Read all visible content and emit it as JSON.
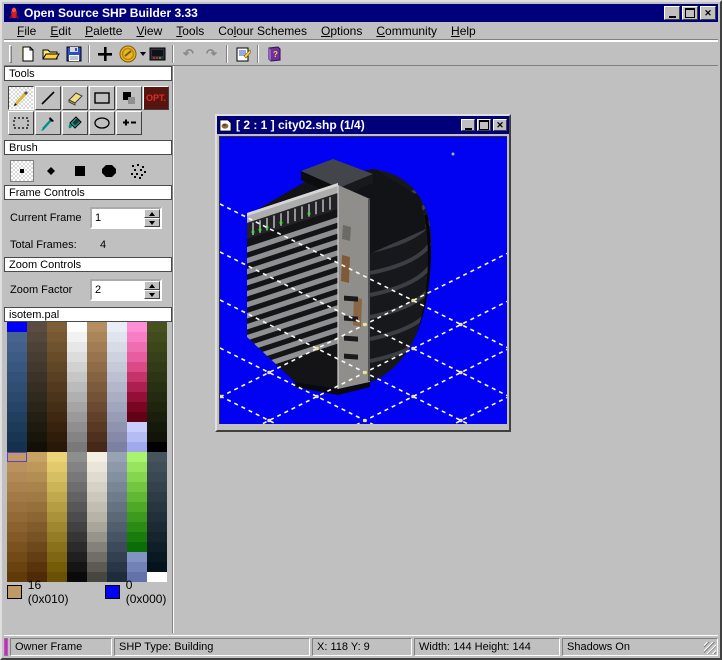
{
  "window": {
    "title": "Open Source SHP Builder 3.33"
  },
  "menu": {
    "items": [
      {
        "label": "File",
        "underline": 0
      },
      {
        "label": "Edit",
        "underline": 0
      },
      {
        "label": "Palette",
        "underline": 0
      },
      {
        "label": "View",
        "underline": 0
      },
      {
        "label": "Tools",
        "underline": 0
      },
      {
        "label": "Colour Schemes",
        "underline": 2
      },
      {
        "label": "Options",
        "underline": 0
      },
      {
        "label": "Community",
        "underline": 0
      },
      {
        "label": "Help",
        "underline": 0
      }
    ]
  },
  "toolbar": {
    "icons": [
      "new-file-icon",
      "open-file-icon",
      "save-file-icon",
      "plus-icon",
      "palette-coin-icon",
      "dropdown-arrow-icon",
      "screen-icon",
      "undo-icon",
      "redo-icon",
      "properties-icon",
      "help-book-icon"
    ]
  },
  "sidebar": {
    "tools": {
      "header": "Tools",
      "row1": [
        "pencil",
        "line",
        "eraser",
        "rectangle",
        "stamp",
        "opt"
      ],
      "row2": [
        "select",
        "eyedropper",
        "fill",
        "ellipse",
        "plus-minus"
      ],
      "opt_label": "OPT."
    },
    "brush": {
      "header": "Brush",
      "items": [
        "brush-small-square",
        "brush-dot",
        "brush-square",
        "brush-round",
        "brush-spray"
      ]
    },
    "frame_controls": {
      "header": "Frame Controls",
      "current_frame_label": "Current Frame",
      "current_frame_value": "1",
      "total_frames_label": "Total Frames:",
      "total_frames_value": "4"
    },
    "zoom_controls": {
      "header": "Zoom Controls",
      "zoom_factor_label": "Zoom Factor",
      "zoom_factor_value": "2"
    },
    "palette": {
      "header": "isotem.pal",
      "marked_cell": {
        "section": 1,
        "row": 0,
        "col": 0
      },
      "columns_top": [
        [
          "#0000f8",
          "#47648c",
          "#426089",
          "#3d5b83",
          "#38577d",
          "#345277",
          "#2f4e71",
          "#2a496b",
          "#264465",
          "#21405f",
          "#1d3b59",
          "#183653",
          "#14314d"
        ],
        [
          "#5a4c41",
          "#54473c",
          "#4e4237",
          "#483d32",
          "#42382d",
          "#3c3328",
          "#362e23",
          "#30291e",
          "#2a2419",
          "#241f14",
          "#1e1a10",
          "#18150b",
          "#121006"
        ],
        [
          "#7d5e36",
          "#765832",
          "#6f522e",
          "#684c2a",
          "#614626",
          "#5a4022",
          "#533a1e",
          "#4c341a",
          "#452e16",
          "#3e2812",
          "#37220e",
          "#301c0a",
          "#291807"
        ],
        [
          "#fdfdfd",
          "#f2f2f2",
          "#e7e7e7",
          "#dcdcdc",
          "#d1d1d1",
          "#c6c6c6",
          "#bbbbbb",
          "#b0b0b0",
          "#a5a5a5",
          "#9a9a9a",
          "#8f8f8f",
          "#848484",
          "#797979"
        ],
        [
          "#b28e60",
          "#a9855a",
          "#a07d54",
          "#97744e",
          "#8e6c48",
          "#856342",
          "#7c5b3c",
          "#735236",
          "#6a4a30",
          "#61412a",
          "#583924",
          "#4f301e",
          "#462818"
        ],
        [
          "#e9edf5",
          "#e0e4ee",
          "#d7dbe7",
          "#ced2e0",
          "#c5c9d9",
          "#bcc0d2",
          "#b3b7cb",
          "#aaaec4",
          "#a1a5bd",
          "#989cb6",
          "#8f93af",
          "#868aa8",
          "#7d81a1"
        ],
        [
          "#ff8ed6",
          "#f77ec4",
          "#ef6eb2",
          "#e75ea0",
          "#d94a86",
          "#c4336a",
          "#ac1f4e",
          "#930f36",
          "#7a0522",
          "#620214",
          "#c9cdfd",
          "#b5bbf5",
          "#a1a9ed"
        ],
        [
          "#47511f",
          "#424b1d",
          "#3d451b",
          "#384019",
          "#333a17",
          "#2e3515",
          "#292f13",
          "#242a11",
          "#1f240f",
          "#1a1f0d",
          "#15190b",
          "#101409",
          "#000000"
        ]
      ],
      "columns_bottom": [
        [
          "#c19a67",
          "#b9925f",
          "#b18a57",
          "#a9824f",
          "#a17a47",
          "#99723f",
          "#916a37",
          "#89622f",
          "#815a27",
          "#795220",
          "#714a18",
          "#694210",
          "#613a0a"
        ],
        [
          "#c7a262",
          "#bd985a",
          "#b38e52",
          "#a9844a",
          "#9f7a42",
          "#95703a",
          "#8b6632",
          "#815c2a",
          "#775222",
          "#6d481a",
          "#633e12",
          "#59340a",
          "#4f2a04"
        ],
        [
          "#ecd476",
          "#e1c96c",
          "#d6be62",
          "#cbb358",
          "#c0a84e",
          "#b59d44",
          "#aa923a",
          "#9f8730",
          "#947c26",
          "#89711c",
          "#7e6612",
          "#735b08",
          "#685004"
        ],
        [
          "#8e8e8e",
          "#838383",
          "#787878",
          "#6d6d6d",
          "#626262",
          "#575757",
          "#4c4c4c",
          "#414141",
          "#363636",
          "#2b2b2b",
          "#202020",
          "#151515",
          "#0a0a0a"
        ],
        [
          "#f3f0e3",
          "#e9e6d9",
          "#dfdccf",
          "#d5d2c5",
          "#cbc8bb",
          "#c1beb1",
          "#b7b4a7",
          "#a8a59a",
          "#97948b",
          "#84817a",
          "#706e66",
          "#5c5a53",
          "#484640"
        ],
        [
          "#97a3b3",
          "#8d99a9",
          "#83909f",
          "#798695",
          "#6f7c8b",
          "#657281",
          "#5b6877",
          "#515e6d",
          "#475463",
          "#3d4a59",
          "#33404f",
          "#293645",
          "#1f2c3b"
        ],
        [
          "#a9f46e",
          "#97e55e",
          "#85d64e",
          "#73c740",
          "#61b834",
          "#4fa928",
          "#3d9a1e",
          "#2b8b14",
          "#197c0c",
          "#0a6e06",
          "#8292c2",
          "#7282b6",
          "#6272aa"
        ],
        [
          "#46545e",
          "#404e58",
          "#3a4852",
          "#34424c",
          "#2e3c46",
          "#283640",
          "#22303a",
          "#1c2a34",
          "#16242e",
          "#101e28",
          "#0a1822",
          "#04121c",
          "#ffffff"
        ]
      ],
      "foreground": {
        "label": "16 (0x010)",
        "color": "#bf9a66"
      },
      "background": {
        "label": "0 (0x000)",
        "color": "#0000f8"
      }
    }
  },
  "document_window": {
    "title": "[ 2 : 1 ] city02.shp (1/4)"
  },
  "canvas": {
    "size": 287,
    "bg": "#0202f2",
    "grid": {
      "a_offsets": [
        67,
        115,
        163,
        211,
        259
      ],
      "b_offsets": [
        260,
        308,
        356,
        404
      ],
      "line_color": "#fafafa",
      "dash": "4 4",
      "dot_color": "#e8e292",
      "dot_min_y": 150
    }
  },
  "status_bar": {
    "panels": [
      "Owner Frame",
      "SHP Type: Building",
      "X: 118 Y: 9",
      "Width: 144 Height: 144",
      "Shadows On"
    ]
  },
  "colors": {
    "titlebar": "#00007b",
    "chrome": "#c0c0c0",
    "canvas_bg": "#0202f2"
  }
}
